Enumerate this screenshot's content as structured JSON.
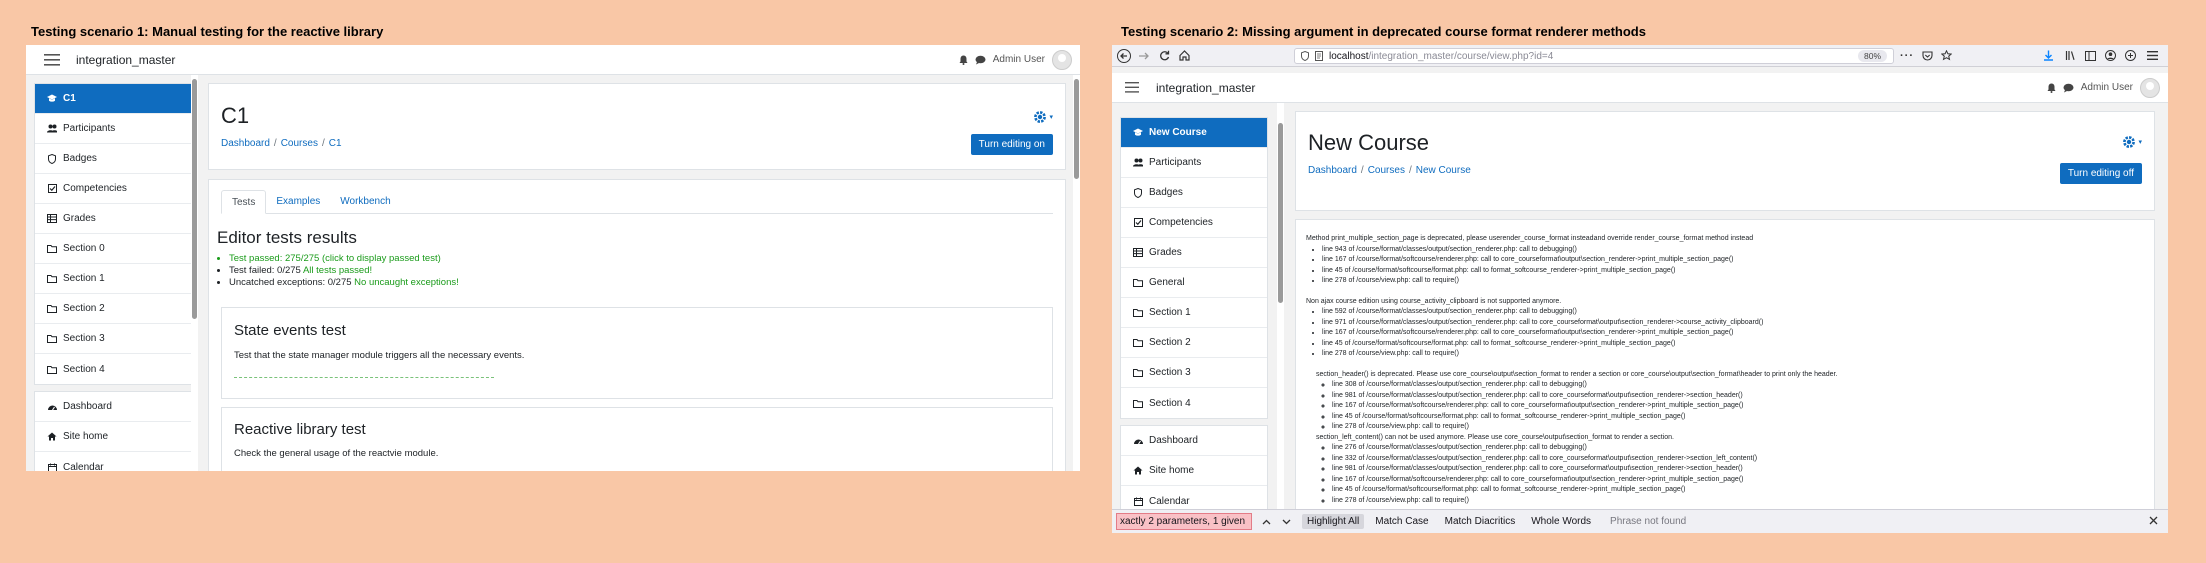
{
  "scenario1": {
    "title": "Testing scenario 1: Manual testing for the reactive library",
    "navbar": {
      "site_name": "integration_master",
      "user": "Admin User"
    },
    "drawer": {
      "course_items": [
        {
          "label": "C1",
          "icon": "graduation-cap-icon",
          "active": true
        },
        {
          "label": "Participants",
          "icon": "users-icon"
        },
        {
          "label": "Badges",
          "icon": "shield-icon"
        },
        {
          "label": "Competencies",
          "icon": "check-square-icon"
        },
        {
          "label": "Grades",
          "icon": "table-icon"
        },
        {
          "label": "Section 0",
          "icon": "folder-icon"
        },
        {
          "label": "Section 1",
          "icon": "folder-icon"
        },
        {
          "label": "Section 2",
          "icon": "folder-icon"
        },
        {
          "label": "Section 3",
          "icon": "folder-icon"
        },
        {
          "label": "Section 4",
          "icon": "folder-icon"
        }
      ],
      "site_items": [
        {
          "label": "Dashboard",
          "icon": "tachometer-icon"
        },
        {
          "label": "Site home",
          "icon": "home-icon"
        },
        {
          "label": "Calendar",
          "icon": "calendar-icon"
        }
      ]
    },
    "header": {
      "title": "C1",
      "breadcrumb": [
        "Dashboard",
        "Courses",
        "C1"
      ],
      "edit_button": "Turn editing on"
    },
    "tabs": [
      "Tests",
      "Examples",
      "Workbench"
    ],
    "results": {
      "title": "Editor tests results",
      "passed_label": "Test passed: 275/275 (click to display passed test)",
      "failed_label": "Test failed: 0/275",
      "failed_note": "All tests passed!",
      "exceptions_label": "Uncatched exceptions: 0/275",
      "exceptions_note": "No uncaught exceptions!"
    },
    "boxes": [
      {
        "title": "State events test",
        "description": "Test that the state manager module triggers all the necessary events."
      },
      {
        "title": "Reactive library test",
        "description": "Check the general usage of the reactvie module."
      }
    ]
  },
  "scenario2": {
    "title": "Testing scenario 2: Missing argument in deprecated course format renderer methods",
    "browser": {
      "url_host": "localhost",
      "url_path": "/integration_master/course/view.php?id=4",
      "zoom": "80%"
    },
    "navbar": {
      "site_name": "integration_master",
      "user": "Admin User"
    },
    "drawer": {
      "course_items": [
        {
          "label": "New Course",
          "icon": "graduation-cap-icon",
          "active": true
        },
        {
          "label": "Participants",
          "icon": "users-icon"
        },
        {
          "label": "Badges",
          "icon": "shield-icon"
        },
        {
          "label": "Competencies",
          "icon": "check-square-icon"
        },
        {
          "label": "Grades",
          "icon": "table-icon"
        },
        {
          "label": "General",
          "icon": "folder-icon"
        },
        {
          "label": "Section 1",
          "icon": "folder-icon"
        },
        {
          "label": "Section 2",
          "icon": "folder-icon"
        },
        {
          "label": "Section 3",
          "icon": "folder-icon"
        },
        {
          "label": "Section 4",
          "icon": "folder-icon"
        }
      ],
      "site_items": [
        {
          "label": "Dashboard",
          "icon": "tachometer-icon"
        },
        {
          "label": "Site home",
          "icon": "home-icon"
        },
        {
          "label": "Calendar",
          "icon": "calendar-icon"
        }
      ]
    },
    "header": {
      "title": "New Course",
      "breadcrumb": [
        "Dashboard",
        "Courses",
        "New Course"
      ],
      "edit_button": "Turn editing off"
    },
    "debug": [
      {
        "message": "Method print_multiple_section_page is deprecated, please userender_course_format insteadand override render_course_format method instead",
        "sub": false,
        "lines": [
          "line 943 of /course/format/classes/output/section_renderer.php: call to debugging()",
          "line 167 of /course/format/softcourse/renderer.php: call to core_courseformat\\output\\section_renderer->print_multiple_section_page()",
          "line 45 of /course/format/softcourse/format.php: call to format_softcourse_renderer->print_multiple_section_page()",
          "line 278 of /course/view.php: call to require()"
        ]
      },
      {
        "message": "Non ajax course edition using course_activity_clipboard is not supported anymore.",
        "sub": false,
        "lines": [
          "line 592 of /course/format/classes/output/section_renderer.php: call to debugging()",
          "line 971 of /course/format/classes/output/section_renderer.php: call to core_courseformat\\output\\section_renderer->course_activity_clipboard()",
          "line 167 of /course/format/softcourse/renderer.php: call to core_courseformat\\output\\section_renderer->print_multiple_section_page()",
          "line 45 of /course/format/softcourse/format.php: call to format_softcourse_renderer->print_multiple_section_page()",
          "line 278 of /course/view.php: call to require()"
        ]
      },
      {
        "message": "section_header() is deprecated. Please use core_course\\output\\section_format to render a section or core_course\\output\\section_format\\header to print only the header.",
        "sub": true,
        "lines": [
          "line 308 of /course/format/classes/output/section_renderer.php: call to debugging()",
          "line 981 of /course/format/classes/output/section_renderer.php: call to core_courseformat\\output\\section_renderer->section_header()",
          "line 167 of /course/format/softcourse/renderer.php: call to core_courseformat\\output\\section_renderer->print_multiple_section_page()",
          "line 45 of /course/format/softcourse/format.php: call to format_softcourse_renderer->print_multiple_section_page()",
          "line 278 of /course/view.php: call to require()"
        ]
      },
      {
        "message": "section_left_content() can not be used anymore. Please use core_course\\output\\section_format to render a section.",
        "sub": true,
        "lines": [
          "line 276 of /course/format/classes/output/section_renderer.php: call to debugging()",
          "line 332 of /course/format/classes/output/section_renderer.php: call to core_courseformat\\output\\section_renderer->section_left_content()",
          "line 981 of /course/format/classes/output/section_renderer.php: call to core_courseformat\\output\\section_renderer->section_header()",
          "line 167 of /course/format/softcourse/renderer.php: call to core_courseformat\\output\\section_renderer->print_multiple_section_page()",
          "line 45 of /course/format/softcourse/format.php: call to format_softcourse_renderer->print_multiple_section_page()",
          "line 278 of /course/view.php: call to require()"
        ]
      }
    ],
    "findbar": {
      "query": "xactly 2 parameters, 1 given",
      "highlight_all": "Highlight All",
      "match_case": "Match Case",
      "match_diacritics": "Match Diacritics",
      "whole_words": "Whole Words",
      "status": "Phrase not found"
    }
  }
}
